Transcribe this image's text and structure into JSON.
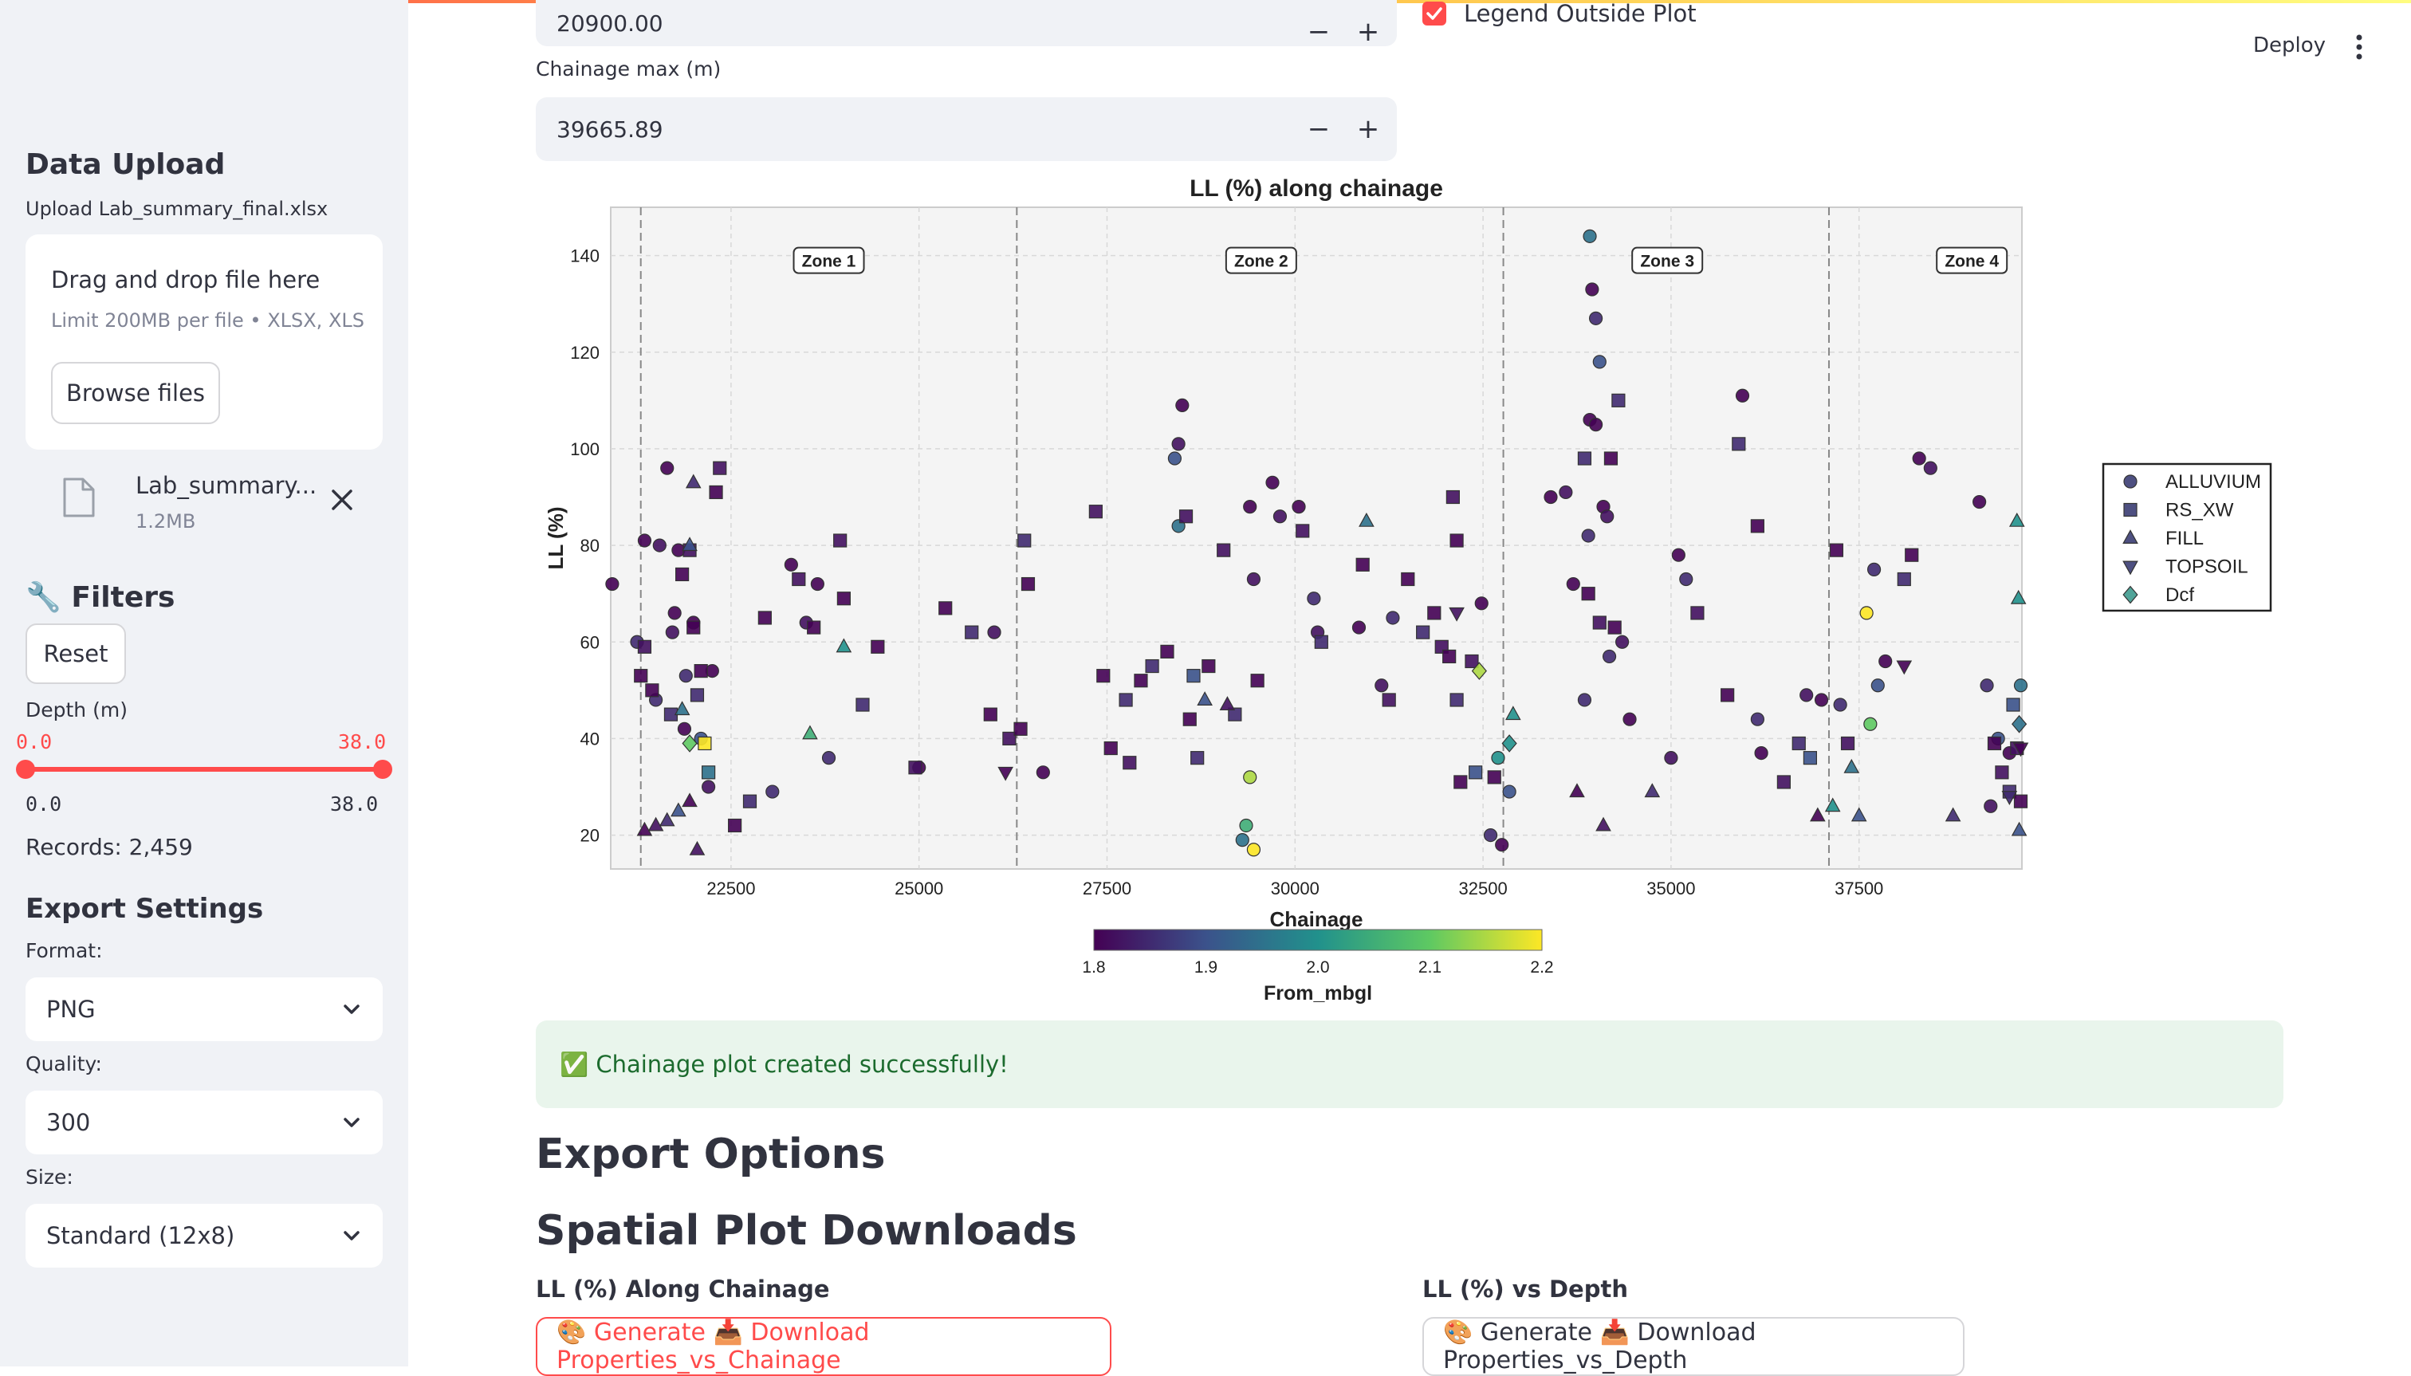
{
  "sidebar": {
    "data_upload_title": "Data Upload",
    "upload_label": "Upload Lab_summary_final.xlsx",
    "dropzone_title": "Drag and drop file here",
    "dropzone_hint": "Limit 200MB per file • XLSX, XLS",
    "browse_label": "Browse files",
    "file_name": "Lab_summary...",
    "file_size": "1.2MB",
    "filters_title": "🔧 Filters",
    "reset_label": "Reset",
    "depth_label": "Depth (m)",
    "depth_min": "0.0",
    "depth_max": "38.0",
    "depth_min_tick": "0.0",
    "depth_max_tick": "38.0",
    "records": "Records: 2,459",
    "export_title": "Export Settings",
    "format_label": "Format:",
    "format_value": "PNG",
    "quality_label": "Quality:",
    "quality_value": "300",
    "size_label": "Size:",
    "size_value": "Standard (12x8)"
  },
  "header": {
    "deploy_label": "Deploy"
  },
  "controls": {
    "chainage_min_value": "20900.00",
    "legend_outside_label": "Legend Outside Plot",
    "legend_outside_checked": true,
    "chainage_max_label": "Chainage max (m)",
    "chainage_max_value": "39665.89",
    "minus": "−",
    "plus": "+"
  },
  "chart_data": {
    "type": "scatter",
    "title": "LL (%) along chainage",
    "xlabel": "Chainage",
    "ylabel": "LL (%)",
    "xlim": [
      20900,
      39666
    ],
    "ylim": [
      13,
      150
    ],
    "x_ticks": [
      22500,
      25000,
      27500,
      30000,
      32500,
      35000,
      37500
    ],
    "y_ticks": [
      20,
      40,
      60,
      80,
      100,
      120,
      140
    ],
    "grid": true,
    "zone_lines": [
      21300,
      26300,
      32770,
      37100
    ],
    "zones": [
      {
        "label": "Zone 1",
        "x": 23800
      },
      {
        "label": "Zone 2",
        "x": 29550
      },
      {
        "label": "Zone 3",
        "x": 34950
      },
      {
        "label": "Zone 4",
        "x": 39000
      }
    ],
    "legend": [
      "ALLUVIUM",
      "RS_XW",
      "FILL",
      "TOPSOIL",
      "Dcf"
    ],
    "legend_placement": "outside-right",
    "colorbar": {
      "label": "From_mbgl",
      "min": 1.8,
      "max": 2.2,
      "ticks": [
        "1.8",
        "1.9",
        "2.0",
        "2.1",
        "2.2"
      ]
    },
    "colormap": [
      "#440154",
      "#3b528b",
      "#21918c",
      "#5ec962",
      "#fde725"
    ],
    "series": [
      {
        "name": "ALLUVIUM",
        "marker": "circle",
        "points": [
          [
            20920,
            72,
            1.8
          ],
          [
            21250,
            60,
            1.85
          ],
          [
            21350,
            81,
            1.8
          ],
          [
            21550,
            80,
            1.82
          ],
          [
            21800,
            79,
            1.8
          ],
          [
            21650,
            96,
            1.8
          ],
          [
            21500,
            48,
            1.85
          ],
          [
            21750,
            66,
            1.8
          ],
          [
            21720,
            62,
            1.82
          ],
          [
            21900,
            53,
            1.85
          ],
          [
            22000,
            64,
            1.8
          ],
          [
            22100,
            40,
            1.9
          ],
          [
            22200,
            30,
            1.82
          ],
          [
            22250,
            54,
            1.8
          ],
          [
            21880,
            42,
            1.8
          ],
          [
            23050,
            29,
            1.85
          ],
          [
            23300,
            76,
            1.8
          ],
          [
            23500,
            64,
            1.82
          ],
          [
            23650,
            72,
            1.8
          ],
          [
            23800,
            36,
            1.85
          ],
          [
            25000,
            34,
            1.8
          ],
          [
            26000,
            62,
            1.82
          ],
          [
            26650,
            33,
            1.8
          ],
          [
            28450,
            101,
            1.82
          ],
          [
            28500,
            109,
            1.8
          ],
          [
            28400,
            98,
            1.9
          ],
          [
            28450,
            84,
            1.95
          ],
          [
            29300,
            19,
            1.95
          ],
          [
            29350,
            22,
            2.05
          ],
          [
            29400,
            32,
            2.15
          ],
          [
            29450,
            17,
            2.2
          ],
          [
            29400,
            88,
            1.8
          ],
          [
            29450,
            73,
            1.82
          ],
          [
            29700,
            93,
            1.8
          ],
          [
            29800,
            86,
            1.82
          ],
          [
            30050,
            88,
            1.8
          ],
          [
            30250,
            69,
            1.85
          ],
          [
            30300,
            62,
            1.82
          ],
          [
            30850,
            63,
            1.8
          ],
          [
            31150,
            51,
            1.82
          ],
          [
            31300,
            65,
            1.85
          ],
          [
            32480,
            68,
            1.8
          ],
          [
            32600,
            20,
            1.85
          ],
          [
            32750,
            18,
            1.8
          ],
          [
            32850,
            29,
            1.9
          ],
          [
            32700,
            36,
            2.0
          ],
          [
            33400,
            90,
            1.8
          ],
          [
            33600,
            91,
            1.82
          ],
          [
            33700,
            72,
            1.8
          ],
          [
            33850,
            48,
            1.85
          ],
          [
            33920,
            144,
            1.95
          ],
          [
            33950,
            133,
            1.8
          ],
          [
            34000,
            127,
            1.85
          ],
          [
            34050,
            118,
            1.9
          ],
          [
            34100,
            88,
            1.8
          ],
          [
            34150,
            86,
            1.82
          ],
          [
            34180,
            57,
            1.85
          ],
          [
            33920,
            106,
            1.8
          ],
          [
            33900,
            82,
            1.85
          ],
          [
            34000,
            105,
            1.8
          ],
          [
            34350,
            60,
            1.82
          ],
          [
            34450,
            44,
            1.8
          ],
          [
            35000,
            36,
            1.82
          ],
          [
            35100,
            78,
            1.8
          ],
          [
            35200,
            73,
            1.85
          ],
          [
            35950,
            111,
            1.8
          ],
          [
            36150,
            44,
            1.85
          ],
          [
            36200,
            37,
            1.8
          ],
          [
            36800,
            49,
            1.82
          ],
          [
            37000,
            48,
            1.8
          ],
          [
            37250,
            47,
            1.85
          ],
          [
            37600,
            66,
            2.2
          ],
          [
            37650,
            43,
            2.1
          ],
          [
            37700,
            75,
            1.85
          ],
          [
            37750,
            51,
            1.9
          ],
          [
            37850,
            56,
            1.8
          ],
          [
            38300,
            98,
            1.8
          ],
          [
            38450,
            96,
            1.82
          ],
          [
            39100,
            89,
            1.8
          ],
          [
            39200,
            51,
            1.85
          ],
          [
            39250,
            26,
            1.82
          ],
          [
            39350,
            40,
            1.9
          ],
          [
            39500,
            37,
            1.8
          ],
          [
            39650,
            51,
            1.95
          ]
        ]
      },
      {
        "name": "RS_XW",
        "marker": "square",
        "points": [
          [
            21300,
            53,
            1.8
          ],
          [
            21350,
            59,
            1.82
          ],
          [
            21450,
            50,
            1.8
          ],
          [
            21700,
            45,
            1.85
          ],
          [
            21850,
            74,
            1.8
          ],
          [
            21950,
            79,
            1.82
          ],
          [
            22000,
            63,
            1.8
          ],
          [
            22050,
            49,
            1.85
          ],
          [
            22100,
            54,
            1.8
          ],
          [
            22150,
            39,
            2.2
          ],
          [
            22200,
            33,
            1.95
          ],
          [
            22300,
            91,
            1.8
          ],
          [
            22350,
            96,
            1.82
          ],
          [
            22550,
            22,
            1.8
          ],
          [
            22750,
            27,
            1.85
          ],
          [
            22950,
            65,
            1.8
          ],
          [
            23400,
            73,
            1.82
          ],
          [
            23600,
            63,
            1.8
          ],
          [
            23950,
            81,
            1.82
          ],
          [
            24000,
            69,
            1.8
          ],
          [
            24250,
            47,
            1.85
          ],
          [
            24450,
            59,
            1.8
          ],
          [
            24950,
            34,
            1.82
          ],
          [
            25350,
            67,
            1.8
          ],
          [
            25700,
            62,
            1.85
          ],
          [
            25950,
            45,
            1.8
          ],
          [
            26200,
            40,
            1.82
          ],
          [
            26350,
            42,
            1.8
          ],
          [
            26400,
            81,
            1.85
          ],
          [
            26450,
            72,
            1.8
          ],
          [
            27350,
            87,
            1.82
          ],
          [
            27450,
            53,
            1.8
          ],
          [
            27750,
            48,
            1.85
          ],
          [
            27550,
            38,
            1.8
          ],
          [
            27800,
            35,
            1.82
          ],
          [
            27950,
            52,
            1.8
          ],
          [
            28100,
            55,
            1.85
          ],
          [
            28300,
            58,
            1.8
          ],
          [
            28550,
            86,
            1.82
          ],
          [
            28600,
            44,
            1.8
          ],
          [
            28650,
            53,
            1.9
          ],
          [
            28700,
            36,
            1.85
          ],
          [
            28850,
            55,
            1.8
          ],
          [
            29050,
            79,
            1.82
          ],
          [
            29200,
            45,
            1.85
          ],
          [
            29500,
            52,
            1.8
          ],
          [
            30100,
            83,
            1.82
          ],
          [
            30350,
            60,
            1.85
          ],
          [
            30900,
            76,
            1.8
          ],
          [
            31250,
            48,
            1.82
          ],
          [
            31500,
            73,
            1.8
          ],
          [
            31700,
            62,
            1.85
          ],
          [
            31850,
            66,
            1.8
          ],
          [
            31950,
            59,
            1.82
          ],
          [
            32050,
            57,
            1.8
          ],
          [
            32100,
            90,
            1.82
          ],
          [
            32150,
            81,
            1.8
          ],
          [
            32150,
            48,
            1.85
          ],
          [
            32200,
            31,
            1.8
          ],
          [
            32350,
            56,
            1.82
          ],
          [
            32400,
            33,
            1.9
          ],
          [
            32650,
            32,
            1.8
          ],
          [
            33850,
            98,
            1.85
          ],
          [
            33900,
            70,
            1.8
          ],
          [
            34050,
            64,
            1.82
          ],
          [
            34200,
            98,
            1.8
          ],
          [
            34300,
            110,
            1.85
          ],
          [
            34250,
            63,
            1.8
          ],
          [
            35350,
            66,
            1.82
          ],
          [
            35750,
            49,
            1.8
          ],
          [
            35900,
            101,
            1.85
          ],
          [
            36150,
            84,
            1.8
          ],
          [
            36500,
            31,
            1.82
          ],
          [
            36700,
            39,
            1.85
          ],
          [
            36850,
            36,
            1.9
          ],
          [
            37200,
            79,
            1.8
          ],
          [
            37350,
            39,
            1.82
          ],
          [
            38200,
            78,
            1.8
          ],
          [
            38100,
            73,
            1.85
          ],
          [
            39300,
            39,
            1.8
          ],
          [
            39400,
            33,
            1.82
          ],
          [
            39500,
            29,
            1.85
          ],
          [
            39550,
            47,
            1.9
          ],
          [
            39600,
            38,
            1.82
          ],
          [
            39650,
            27,
            1.8
          ]
        ]
      },
      {
        "name": "FILL",
        "marker": "triangle-up",
        "points": [
          [
            21350,
            21,
            1.8
          ],
          [
            21500,
            22,
            1.82
          ],
          [
            21650,
            23,
            1.85
          ],
          [
            21800,
            25,
            1.9
          ],
          [
            21950,
            27,
            1.8
          ],
          [
            22050,
            17,
            1.82
          ],
          [
            22000,
            93,
            1.85
          ],
          [
            21950,
            80,
            1.9
          ],
          [
            21850,
            46,
            1.95
          ],
          [
            23550,
            41,
            2.05
          ],
          [
            24000,
            59,
            2.0
          ],
          [
            28800,
            48,
            1.9
          ],
          [
            29100,
            47,
            1.82
          ],
          [
            30950,
            85,
            1.95
          ],
          [
            32900,
            45,
            2.0
          ],
          [
            33750,
            29,
            1.8
          ],
          [
            34100,
            22,
            1.82
          ],
          [
            34750,
            29,
            1.85
          ],
          [
            36950,
            24,
            1.8
          ],
          [
            37150,
            26,
            2.0
          ],
          [
            37400,
            34,
            1.95
          ],
          [
            37500,
            24,
            1.9
          ],
          [
            38750,
            24,
            1.85
          ],
          [
            39600,
            85,
            2.0
          ],
          [
            39620,
            69,
            2.0
          ],
          [
            39630,
            21,
            1.9
          ]
        ]
      },
      {
        "name": "TOPSOIL",
        "marker": "triangle-down",
        "points": [
          [
            26150,
            33,
            1.8
          ],
          [
            32150,
            66,
            1.82
          ],
          [
            38100,
            55,
            1.8
          ],
          [
            39500,
            28,
            1.85
          ],
          [
            39650,
            38,
            1.8
          ]
        ]
      },
      {
        "name": "Dcf",
        "marker": "diamond",
        "points": [
          [
            21950,
            39,
            2.1
          ],
          [
            32450,
            54,
            2.15
          ],
          [
            32850,
            39,
            2.0
          ],
          [
            39630,
            43,
            1.95
          ]
        ]
      }
    ]
  },
  "status": {
    "success_message": "✅ Chainage plot created successfully!"
  },
  "export": {
    "section_title": "Export Options",
    "spatial_title": "Spatial Plot Downloads",
    "left_label": "LL (%) Along Chainage",
    "left_button": "🎨 Generate 📥 Download Properties_vs_Chainage",
    "right_label": "LL (%) vs Depth",
    "right_button": "🎨 Generate 📥 Download Properties_vs_Depth"
  },
  "colors": {
    "accent": "#ff4b4b",
    "success_bg": "#e9f5ec",
    "success_text": "#1c6b2e",
    "sidebar_bg": "#f0f2f6"
  }
}
